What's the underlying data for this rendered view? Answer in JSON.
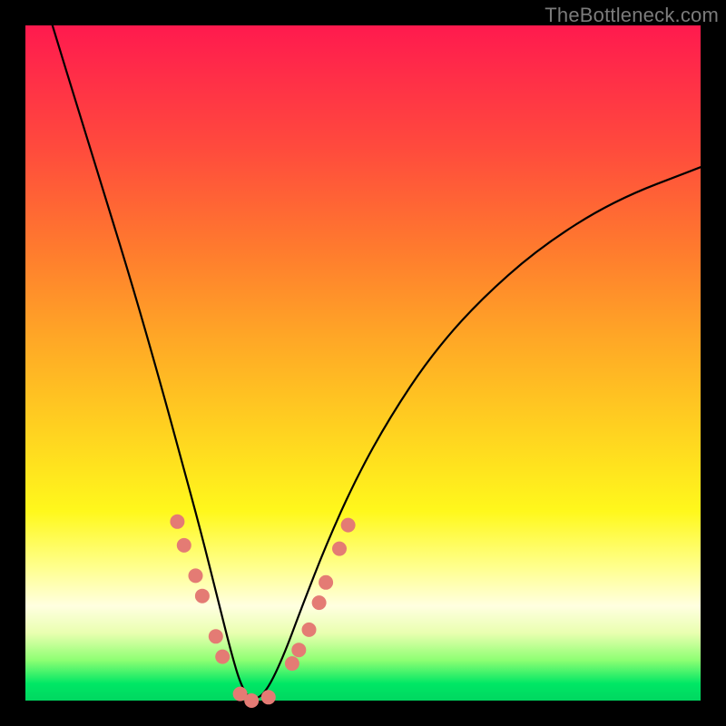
{
  "watermark": "TheBottleneck.com",
  "chart_data": {
    "type": "line",
    "title": "",
    "xlabel": "",
    "ylabel": "",
    "xlim": [
      0,
      1
    ],
    "ylim": [
      0,
      1
    ],
    "note": "Axes are unlabeled; values are normalized to the 744×744 plot area. x is fraction across, y is fraction up from bottom (0 = bottom / green band, 1 = top / red band). Curve is a steep V / bottleneck shape reaching 0 near x≈0.33.",
    "series": [
      {
        "name": "bottleneck-curve",
        "x": [
          0.04,
          0.08,
          0.12,
          0.16,
          0.2,
          0.23,
          0.26,
          0.285,
          0.305,
          0.32,
          0.335,
          0.355,
          0.38,
          0.41,
          0.445,
          0.49,
          0.54,
          0.6,
          0.67,
          0.76,
          0.87,
          1.0
        ],
        "y": [
          1.0,
          0.87,
          0.74,
          0.61,
          0.47,
          0.36,
          0.25,
          0.15,
          0.07,
          0.02,
          0.0,
          0.01,
          0.06,
          0.14,
          0.23,
          0.33,
          0.42,
          0.51,
          0.59,
          0.67,
          0.74,
          0.79
        ]
      }
    ],
    "markers": {
      "name": "highlight-dots",
      "color": "#e47b74",
      "radius_px": 8,
      "points_xy": [
        [
          0.225,
          0.265
        ],
        [
          0.235,
          0.23
        ],
        [
          0.252,
          0.185
        ],
        [
          0.262,
          0.155
        ],
        [
          0.282,
          0.095
        ],
        [
          0.292,
          0.065
        ],
        [
          0.318,
          0.01
        ],
        [
          0.335,
          0.0
        ],
        [
          0.36,
          0.005
        ],
        [
          0.395,
          0.055
        ],
        [
          0.405,
          0.075
        ],
        [
          0.42,
          0.105
        ],
        [
          0.435,
          0.145
        ],
        [
          0.445,
          0.175
        ],
        [
          0.465,
          0.225
        ],
        [
          0.478,
          0.26
        ]
      ]
    },
    "background_gradient": {
      "direction": "top-to-bottom",
      "stops": [
        {
          "pos": 0.0,
          "color": "#ff1a4e"
        },
        {
          "pos": 0.33,
          "color": "#ff7a2e"
        },
        {
          "pos": 0.6,
          "color": "#ffd220"
        },
        {
          "pos": 0.8,
          "color": "#ffff8a"
        },
        {
          "pos": 0.97,
          "color": "#00e765"
        },
        {
          "pos": 1.0,
          "color": "#00d760"
        }
      ]
    }
  }
}
